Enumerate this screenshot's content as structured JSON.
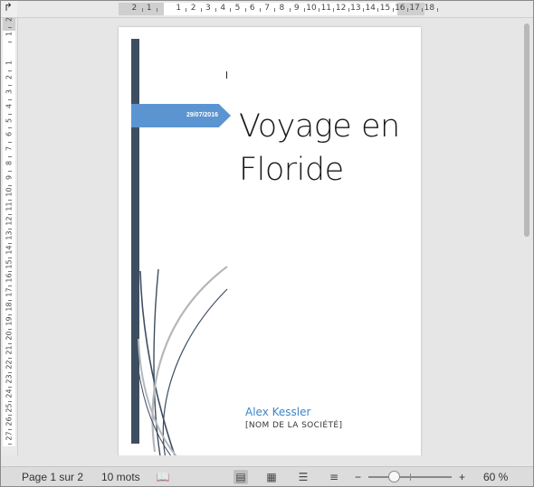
{
  "ruler": {
    "corner_glyph": "↱",
    "h_labels": [
      "2",
      "1",
      "1",
      "2",
      "3",
      "4",
      "5",
      "6",
      "7",
      "8",
      "9",
      "10",
      "11",
      "12",
      "13",
      "14",
      "15",
      "16",
      "17",
      "18"
    ],
    "v_labels": [
      "2",
      "1",
      "1",
      "2",
      "3",
      "4",
      "5",
      "6",
      "7",
      "8",
      "9",
      "10",
      "11",
      "12",
      "13",
      "14",
      "15",
      "16",
      "17",
      "18",
      "19",
      "20",
      "21",
      "22",
      "23",
      "24",
      "25",
      "26",
      "27"
    ]
  },
  "document": {
    "date": "29/07/2016",
    "title_line1": "Voyage en",
    "title_line2": "Floride",
    "author": "Alex Kessler",
    "company": "[NOM DE LA SOCIÉTÉ]",
    "colors": {
      "sidebar": "#3e4e62",
      "date_tab": "#5a95d1",
      "author": "#3b86c5"
    }
  },
  "status": {
    "page": "Page 1 sur 2",
    "words": "10 mots",
    "zoom_minus": "−",
    "zoom_plus": "+",
    "zoom": "60 %",
    "zoom_level": 0.6,
    "icons": [
      "proofing-icon",
      "print-layout-icon",
      "web-layout-icon",
      "outline-icon",
      "draft-icon"
    ]
  }
}
